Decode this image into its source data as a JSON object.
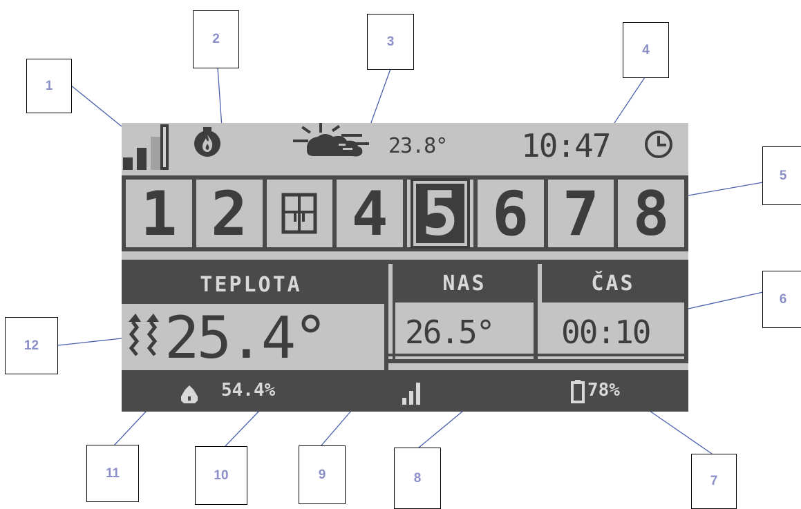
{
  "callouts": [
    "1",
    "2",
    "3",
    "4",
    "5",
    "6",
    "7",
    "8",
    "9",
    "10",
    "11",
    "12"
  ],
  "status_bar": {
    "signal_icon": "signal-bars-icon",
    "heat_icon": "flame-drop-icon",
    "weather_icon": "partly-cloudy-icon",
    "outdoor_temp": "23.8°",
    "time": "10:47",
    "clock_icon": "clock-icon"
  },
  "zones": [
    {
      "label": "1"
    },
    {
      "label": "2"
    },
    {
      "label": "",
      "icon": "window-icon"
    },
    {
      "label": "4"
    },
    {
      "label": "5",
      "active": true
    },
    {
      "label": "6"
    },
    {
      "label": "7"
    },
    {
      "label": "8"
    }
  ],
  "temperature_panel": {
    "header": "TEPLOTA",
    "trend_icon": "heating-waves-icon",
    "value": "25.4°"
  },
  "setpoint_panel": {
    "header": "NAS",
    "value": "26.5°"
  },
  "time_panel": {
    "header": "ČAS",
    "value": "00:10"
  },
  "humidity": {
    "icon": "humidity-drop-icon",
    "value": "54.4%"
  },
  "wireless": {
    "signal_icon": "signal-bars-icon",
    "battery_icon": "battery-icon",
    "battery_value": "78%"
  },
  "colors": {
    "lcd_background": "#c4c4c4",
    "lcd_dark": "#4a4a4a",
    "callout_number": "#8a8fc8",
    "leader_line": "#4a5fae"
  }
}
